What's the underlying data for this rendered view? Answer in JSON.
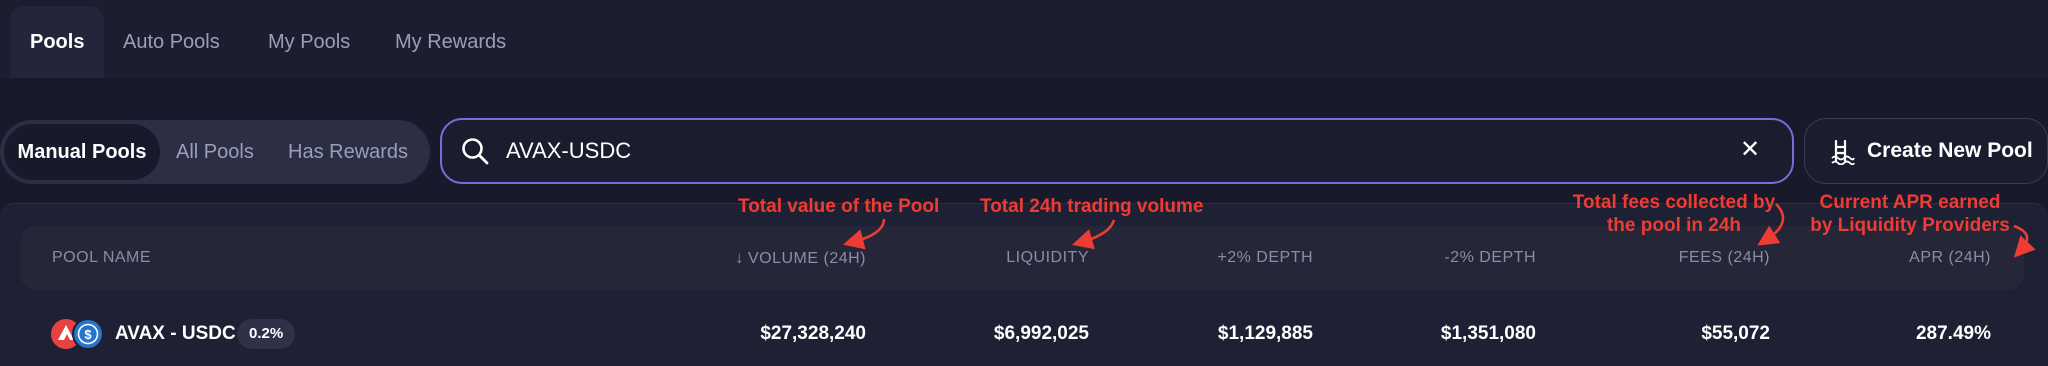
{
  "tabs": [
    {
      "label": "Pools",
      "active": true
    },
    {
      "label": "Auto Pools",
      "active": false
    },
    {
      "label": "My Pools",
      "active": false
    },
    {
      "label": "My Rewards",
      "active": false
    }
  ],
  "filters": [
    {
      "label": "Manual Pools",
      "active": true
    },
    {
      "label": "All Pools",
      "active": false
    },
    {
      "label": "Has Rewards",
      "active": false
    }
  ],
  "search": {
    "value": "AVAX-USDC",
    "icon": "search-icon",
    "clear_icon": "close-icon"
  },
  "create_button": {
    "label": "Create New Pool",
    "icon": "pool-ladder-icon"
  },
  "table": {
    "headers": {
      "pool_name": "POOL NAME",
      "volume": "VOLUME (24H)",
      "liquidity": "LIQUIDITY",
      "depth_plus": "+2% DEPTH",
      "depth_minus": "-2% DEPTH",
      "fees": "FEES (24H)",
      "apr": "APR (24H)"
    },
    "sort": {
      "column": "volume",
      "direction": "desc"
    },
    "rows": [
      {
        "pool": "AVAX - USDC",
        "fee_tier": "0.2%",
        "volume": "$27,328,240",
        "liquidity": "$6,992,025",
        "depth_plus": "$1,129,885",
        "depth_minus": "$1,351,080",
        "fees": "$55,072",
        "apr": "287.49%"
      }
    ]
  },
  "annotations": {
    "volume": "Total value of the Pool",
    "liquidity": "Total 24h trading volume",
    "fees_line1": "Total fees collected by",
    "fees_line2": "the pool in 24h",
    "apr_line1": "Current APR earned",
    "apr_line2": "by Liquidity Providers"
  },
  "colors": {
    "background": "#181a2b",
    "accent_border": "#7b6bd8",
    "annotation": "#ee3c34",
    "avax_red": "#e84142",
    "usdc_blue": "#2775ca"
  }
}
